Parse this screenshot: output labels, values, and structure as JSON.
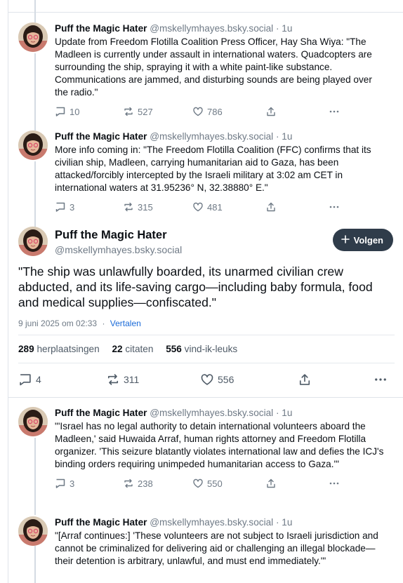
{
  "posts_before": [
    {
      "name": "Puff the Magic Hater",
      "handle": "@mskellymhayes.bsky.social",
      "time": "· 1u",
      "text": "Update from Freedom Flotilla Coalition Press Officer, Hay Sha Wiya: \"The Madleen is currently under assault in international waters. Quadcopters are surrounding the ship, spraying it with a white paint-like substance. Communications are jammed, and disturbing sounds are being played over the radio.\"",
      "replies": "10",
      "reposts": "527",
      "likes": "786"
    },
    {
      "name": "Puff the Magic Hater",
      "handle": "@mskellymhayes.bsky.social",
      "time": "· 1u",
      "text": "More info coming in: \"The Freedom Flotilla Coalition (FFC) confirms that its civilian ship, Madleen, carrying humanitarian aid to Gaza, has been attacked/forcibly intercepted by the Israeli military at 3:02 am CET in international waters at 31.95236° N, 32.38880° E.\"",
      "replies": "3",
      "reposts": "315",
      "likes": "481"
    }
  ],
  "focus": {
    "name": "Puff the Magic Hater",
    "handle": "@mskellymhayes.bsky.social",
    "follow_label": "Volgen",
    "text": "\"The ship was unlawfully boarded, its unarmed civilian crew abducted, and its life-saving cargo—including baby formula, food and medical supplies—confiscated.\"",
    "date": "9 juni 2025 om 02:33",
    "separator": "·",
    "translate": "Vertalen",
    "reposts_count": "289",
    "reposts_label": "herplaatsingen",
    "quotes_count": "22",
    "quotes_label": "citaten",
    "likes_count": "556",
    "likes_label": "vind-ik-leuks",
    "replies": "4",
    "reposts": "311",
    "likes": "556"
  },
  "posts_after": [
    {
      "name": "Puff the Magic Hater",
      "handle": "@mskellymhayes.bsky.social",
      "time": "· 1u",
      "text": "\"'Israel has no legal authority to detain international volunteers aboard the Madleen,' said Huwaida Arraf, human rights attorney and Freedom Flotilla organizer. 'This seizure blatantly violates international law and defies the ICJ's binding orders requiring unimpeded humanitarian access to Gaza.'\"",
      "replies": "3",
      "reposts": "238",
      "likes": "550"
    },
    {
      "name": "Puff the Magic Hater",
      "handle": "@mskellymhayes.bsky.social",
      "time": "· 1u",
      "text": "\"[Arraf continues:] 'These volunteers are not subject to Israeli jurisdiction and cannot be criminalized for delivering aid or challenging an illegal blockade—their detention is arbitrary, unlawful, and must end immediately.'\""
    }
  ],
  "icons": {
    "reply": "speech-bubble-icon",
    "repost": "repost-arrows-icon",
    "like": "heart-icon",
    "share": "share-upload-icon",
    "more": "ellipsis-icon",
    "follow": "plus-icon"
  },
  "colors": {
    "text": "#0b0f14",
    "muted": "#6f7a86",
    "link": "#1a6ad8",
    "follow_button": "#2f3c4a",
    "thread_line": "#d4dbe3"
  }
}
